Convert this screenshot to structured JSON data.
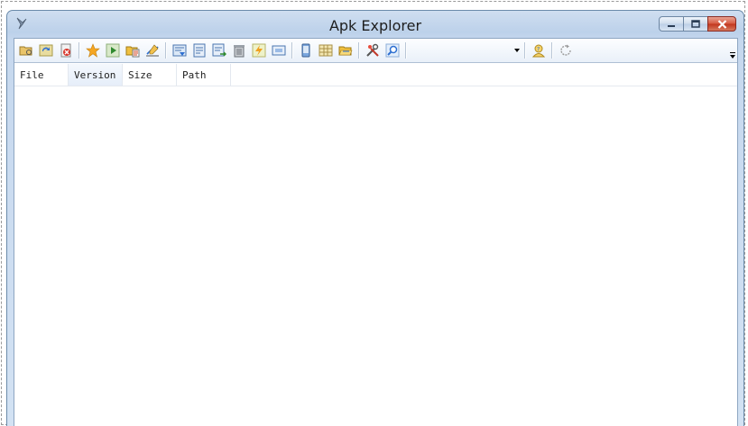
{
  "window": {
    "title": "Apk Explorer"
  },
  "caption_buttons": [
    "minimize",
    "restore",
    "close"
  ],
  "toolbar": {
    "groups": [
      [
        "open-folder",
        "refresh",
        "remove"
      ],
      [
        "favorite-star",
        "play",
        "open-file",
        "edit-chart"
      ],
      [
        "doc-arrow",
        "doc-text",
        "doc-export",
        "trash",
        "lightning",
        "window-box"
      ],
      [
        "device",
        "grid",
        "folder-open"
      ],
      [
        "tools",
        "search"
      ]
    ],
    "combo_value": "",
    "extra_icons": [
      "user-question",
      "reload-circle"
    ]
  },
  "list": {
    "columns": [
      "File",
      "Version",
      "Size",
      "Path"
    ],
    "rows": []
  },
  "colors": {
    "title_bar": "#bcd1ea",
    "close_button": "#c1351c",
    "window_border": "#6b8bab"
  }
}
